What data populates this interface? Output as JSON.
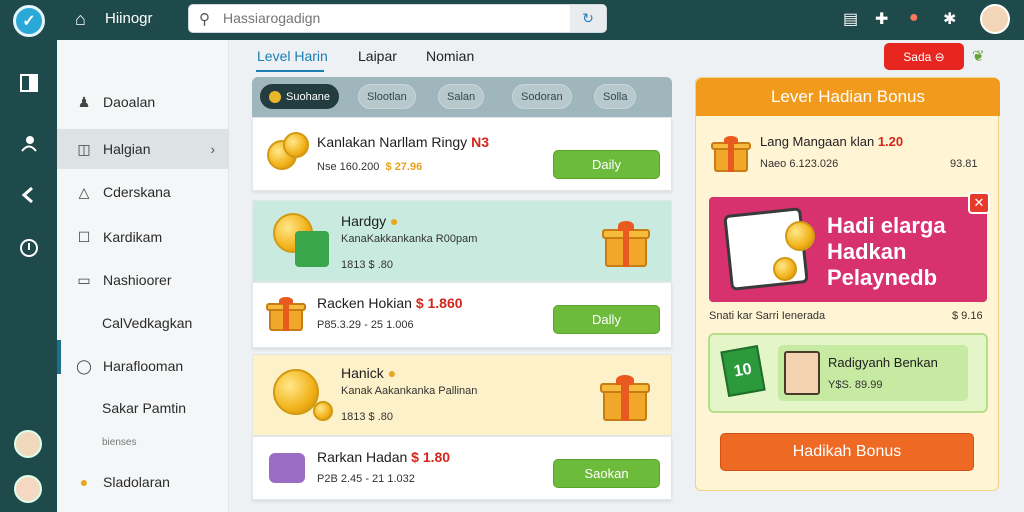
{
  "header": {
    "app_title": "Hiinogr",
    "search_placeholder": "Hassiarogadign"
  },
  "sidebar": {
    "items": [
      {
        "label": "Daoalan"
      },
      {
        "label": "Halgian"
      },
      {
        "label": "Cderskana"
      },
      {
        "label": "Kardikam"
      },
      {
        "label": "Nashioorer"
      },
      {
        "label": "CalVedkagkan"
      },
      {
        "label": "Haraflooman"
      },
      {
        "label": "Sakar Pamtin"
      },
      {
        "label": "Sladolaran"
      }
    ],
    "small_label": "bienses"
  },
  "tabs": [
    {
      "label": "Level Harin"
    },
    {
      "label": "Laipar"
    },
    {
      "label": "Nomian"
    }
  ],
  "top_action": {
    "label": "Sada ⊖"
  },
  "chips": [
    {
      "label": "Suohane"
    },
    {
      "label": "Slootlan"
    },
    {
      "label": "Salan"
    },
    {
      "label": "Sodoran"
    },
    {
      "label": "Solla"
    }
  ],
  "cards": [
    {
      "title": "Kanlakan Narllam Ringy",
      "title_price": "N3",
      "sub": "Nse 160.200",
      "sub_price": "$ 27.96",
      "button": "Daily"
    },
    {
      "title": "Hardgy",
      "desc": "KanaKakkankanka R00pam",
      "sub": "1813 $ .80"
    },
    {
      "title": "Racken Hokian",
      "title_price": "$ 1.860",
      "sub": "P85.3.29 - 25 1.006",
      "button": "Dally"
    },
    {
      "title": "Hanick",
      "desc": "Kanak Aakankanka Pallinan",
      "sub": "1813 $ .80"
    },
    {
      "title": "Rarkan Hadan",
      "title_price": "$ 1.80",
      "sub": "P2B 2.45 - 21 1.032",
      "button": "Saokan"
    }
  ],
  "right_panel": {
    "title": "Lever Hadian Bonus",
    "row1_text": "Lang Mangaan klan",
    "row1_price": "1.20",
    "row1_sub": "Naeo 6.123.026",
    "row1_value": "93.81",
    "promo_line1": "Hadi elarga",
    "promo_line2": "Hadkan",
    "promo_line3": "Pelaynedb",
    "promo_caption": "Snati kar Sarri Ienerada",
    "promo_value": "$ 9.16",
    "winner_name": "Radigyanh Benkan",
    "winner_sub": "Y$S. 89.99",
    "bonus_button": "Hadikah Bonus"
  },
  "colors": {
    "header_bg": "#1f4a4c",
    "accent_green": "#6dbb3a",
    "accent_orange": "#f29a1c",
    "promo_pink": "#d7316e",
    "alert_red": "#e6261f"
  }
}
